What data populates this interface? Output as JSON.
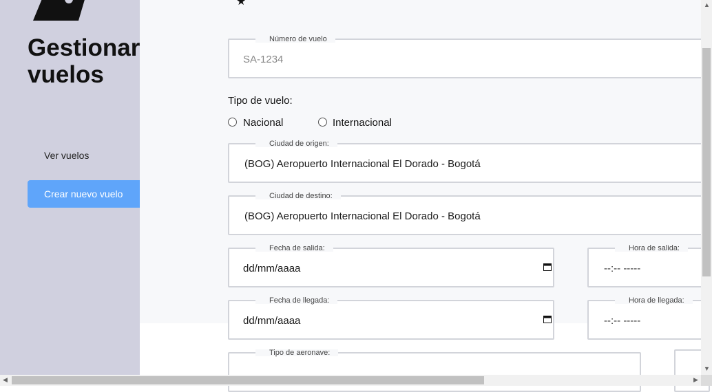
{
  "sidebar": {
    "title_line1": "Gestionar",
    "title_line2": "vuelos",
    "items": [
      {
        "label": "Ver vuelos",
        "active": false
      },
      {
        "label": "Crear nuevo vuelo",
        "active": true
      }
    ],
    "colors": {
      "background": "#d0d0df",
      "active": "#5fa5fa"
    }
  },
  "form": {
    "flight_number": {
      "legend": "Número de vuelo",
      "placeholder": "SA-1234"
    },
    "flight_type": {
      "label": "Tipo de vuelo:",
      "options": [
        "Nacional",
        "Internacional"
      ]
    },
    "origin": {
      "legend": "Ciudad de origen:",
      "value": "(BOG) Aeropuerto Internacional El Dorado - Bogotá"
    },
    "destination": {
      "legend": "Ciudad de destino:",
      "value": "(BOG) Aeropuerto Internacional El Dorado - Bogotá"
    },
    "departure_date": {
      "legend": "Fecha de salida:",
      "value": "dd/mm/aaaa"
    },
    "departure_time": {
      "legend": "Hora de salida:",
      "value": "--:-- -----"
    },
    "arrival_date": {
      "legend": "Fecha de llegada:",
      "value": "dd/mm/aaaa"
    },
    "arrival_time": {
      "legend": "Hora de llegada:",
      "value": "--:-- -----"
    },
    "aircraft_type": {
      "legend": "Tipo de aeronave:"
    }
  },
  "icons": {
    "logo": "plane-logo-icon",
    "calendar": "calendar-icon",
    "star": "star-icon"
  }
}
